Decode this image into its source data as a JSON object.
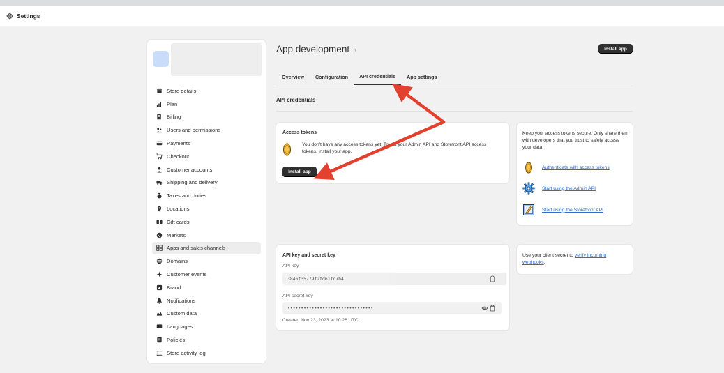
{
  "window": {
    "title": "Settings"
  },
  "sidebar": {
    "items": [
      {
        "label": "Store details",
        "icon": "store-icon"
      },
      {
        "label": "Plan",
        "icon": "chart-icon"
      },
      {
        "label": "Billing",
        "icon": "receipt-icon"
      },
      {
        "label": "Users and permissions",
        "icon": "users-icon"
      },
      {
        "label": "Payments",
        "icon": "payments-icon"
      },
      {
        "label": "Checkout",
        "icon": "cart-icon"
      },
      {
        "label": "Customer accounts",
        "icon": "person-icon"
      },
      {
        "label": "Shipping and delivery",
        "icon": "truck-icon"
      },
      {
        "label": "Taxes and duties",
        "icon": "tax-icon"
      },
      {
        "label": "Locations",
        "icon": "location-icon"
      },
      {
        "label": "Gift cards",
        "icon": "gift-card-icon"
      },
      {
        "label": "Markets",
        "icon": "globe-icon"
      },
      {
        "label": "Apps and sales channels",
        "icon": "apps-icon",
        "active": true
      },
      {
        "label": "Domains",
        "icon": "domain-globe-icon"
      },
      {
        "label": "Customer events",
        "icon": "sparkle-icon"
      },
      {
        "label": "Brand",
        "icon": "brand-icon"
      },
      {
        "label": "Notifications",
        "icon": "bell-icon"
      },
      {
        "label": "Custom data",
        "icon": "database-icon"
      },
      {
        "label": "Languages",
        "icon": "language-icon"
      },
      {
        "label": "Policies",
        "icon": "policy-icon"
      },
      {
        "label": "Store activity log",
        "icon": "list-icon"
      }
    ]
  },
  "header": {
    "title": "App development",
    "install_label": "Install app"
  },
  "tabs": [
    {
      "label": "Overview",
      "active": false
    },
    {
      "label": "Configuration",
      "active": false
    },
    {
      "label": "API credentials",
      "active": true
    },
    {
      "label": "App settings",
      "active": false
    }
  ],
  "section": {
    "title": "API credentials"
  },
  "access_tokens": {
    "heading": "Access tokens",
    "text": "You don't have any access tokens yet. To get your Admin API and Storefront API access tokens, install your app.",
    "button": "Install app"
  },
  "security_card": {
    "text": "Keep your access tokens secure. Only share them with developers that you trust to safely access your data.",
    "links": [
      {
        "label": "Authenticate with access tokens",
        "icon": "coin-icon"
      },
      {
        "label": "Start using the Admin API",
        "icon": "gear-icon"
      },
      {
        "label": "Start using the Storefront API",
        "icon": "storefront-icon"
      }
    ]
  },
  "api_keys": {
    "heading": "API key and secret key",
    "api_key_label": "API key",
    "api_key_value": "3846f35779f2fd61fc7b4",
    "secret_label": "API secret key",
    "secret_value": "••••••••••••••••••••••••••••••••",
    "created": "Created Nov 23, 2023 at 10:28 UTC"
  },
  "client_secret_card": {
    "text_before": "Use your client secret to ",
    "link": "verify incoming webhooks",
    "text_after": "."
  },
  "colors": {
    "accent_link": "#2c6ecb",
    "button_dark": "#303030",
    "annotation_arrow": "#e2412f"
  }
}
